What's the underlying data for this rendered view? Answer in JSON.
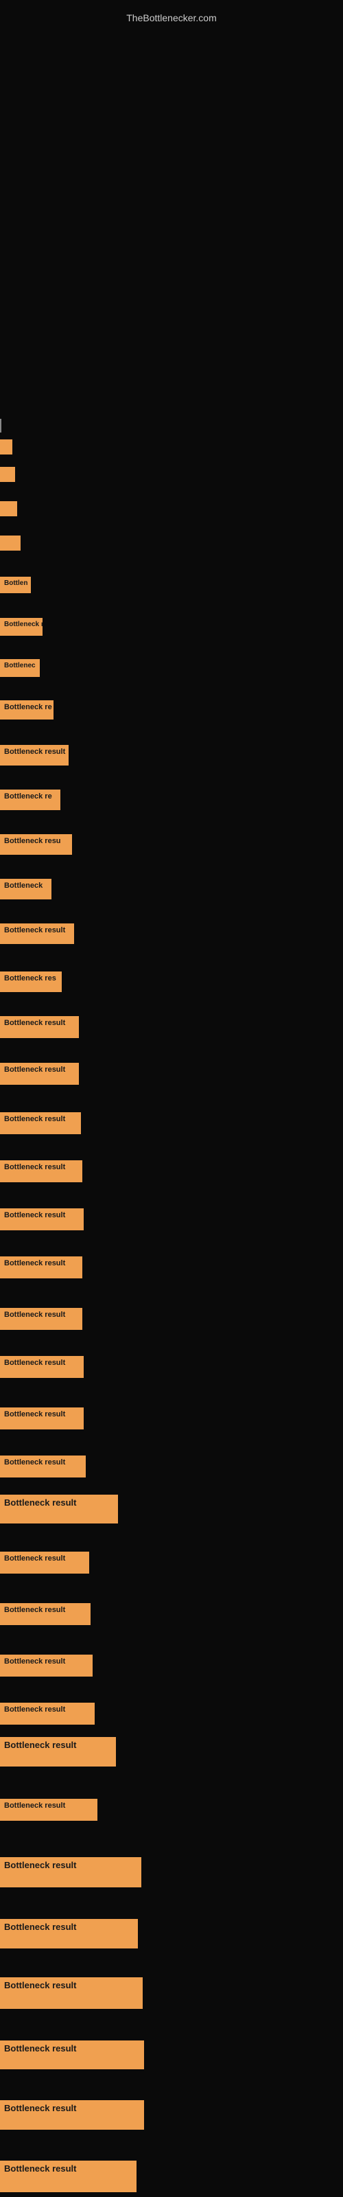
{
  "site": {
    "title": "TheBottlenecker.com"
  },
  "bars": [
    {
      "id": 1,
      "label": "",
      "class": "bar-1"
    },
    {
      "id": 2,
      "label": "",
      "class": "bar-2"
    },
    {
      "id": 3,
      "label": "",
      "class": "bar-3"
    },
    {
      "id": 4,
      "label": "",
      "class": "bar-4"
    },
    {
      "id": 5,
      "label": "Bottlen",
      "class": "bar-5"
    },
    {
      "id": 6,
      "label": "Bottleneck r",
      "class": "bar-6"
    },
    {
      "id": 7,
      "label": "Bottlenec",
      "class": "bar-7"
    },
    {
      "id": 8,
      "label": "Bottleneck re",
      "class": "bar-8"
    },
    {
      "id": 9,
      "label": "Bottleneck result",
      "class": "bar-9"
    },
    {
      "id": 10,
      "label": "Bottleneck re",
      "class": "bar-10"
    },
    {
      "id": 11,
      "label": "Bottleneck resu",
      "class": "bar-11"
    },
    {
      "id": 12,
      "label": "Bottleneck",
      "class": "bar-12"
    },
    {
      "id": 13,
      "label": "Bottleneck result",
      "class": "bar-13"
    },
    {
      "id": 14,
      "label": "Bottleneck res",
      "class": "bar-14"
    },
    {
      "id": 15,
      "label": "Bottleneck result",
      "class": "bar-15"
    },
    {
      "id": 16,
      "label": "Bottleneck result",
      "class": "bar-16"
    },
    {
      "id": 17,
      "label": "Bottleneck result",
      "class": "bar-17"
    },
    {
      "id": 18,
      "label": "Bottleneck result",
      "class": "bar-18"
    },
    {
      "id": 19,
      "label": "Bottleneck result",
      "class": "bar-19"
    },
    {
      "id": 20,
      "label": "Bottleneck result",
      "class": "bar-20"
    },
    {
      "id": 21,
      "label": "Bottleneck result",
      "class": "bar-21"
    },
    {
      "id": 22,
      "label": "Bottleneck result",
      "class": "bar-22"
    },
    {
      "id": 23,
      "label": "Bottleneck result",
      "class": "bar-23"
    },
    {
      "id": 24,
      "label": "Bottleneck result",
      "class": "bar-24"
    },
    {
      "id": 25,
      "label": "Bottleneck result",
      "class": "bar-25"
    },
    {
      "id": 26,
      "label": "Bottleneck result",
      "class": "bar-26"
    },
    {
      "id": 27,
      "label": "Bottleneck result",
      "class": "bar-27"
    },
    {
      "id": 28,
      "label": "Bottleneck result",
      "class": "bar-28"
    },
    {
      "id": 29,
      "label": "Bottleneck result",
      "class": "bar-29"
    },
    {
      "id": 30,
      "label": "Bottleneck result",
      "class": "bar-30"
    },
    {
      "id": 31,
      "label": "Bottleneck result",
      "class": "bar-31"
    },
    {
      "id": 32,
      "label": "Bottleneck result",
      "class": "bar-32"
    },
    {
      "id": 33,
      "label": "Bottleneck result",
      "class": "bar-33"
    },
    {
      "id": 34,
      "label": "Bottleneck result",
      "class": "bar-34"
    },
    {
      "id": 35,
      "label": "Bottleneck result",
      "class": "bar-35"
    },
    {
      "id": 36,
      "label": "Bottleneck result",
      "class": "bar-36"
    },
    {
      "id": 37,
      "label": "Bottleneck result",
      "class": "bar-37"
    }
  ]
}
